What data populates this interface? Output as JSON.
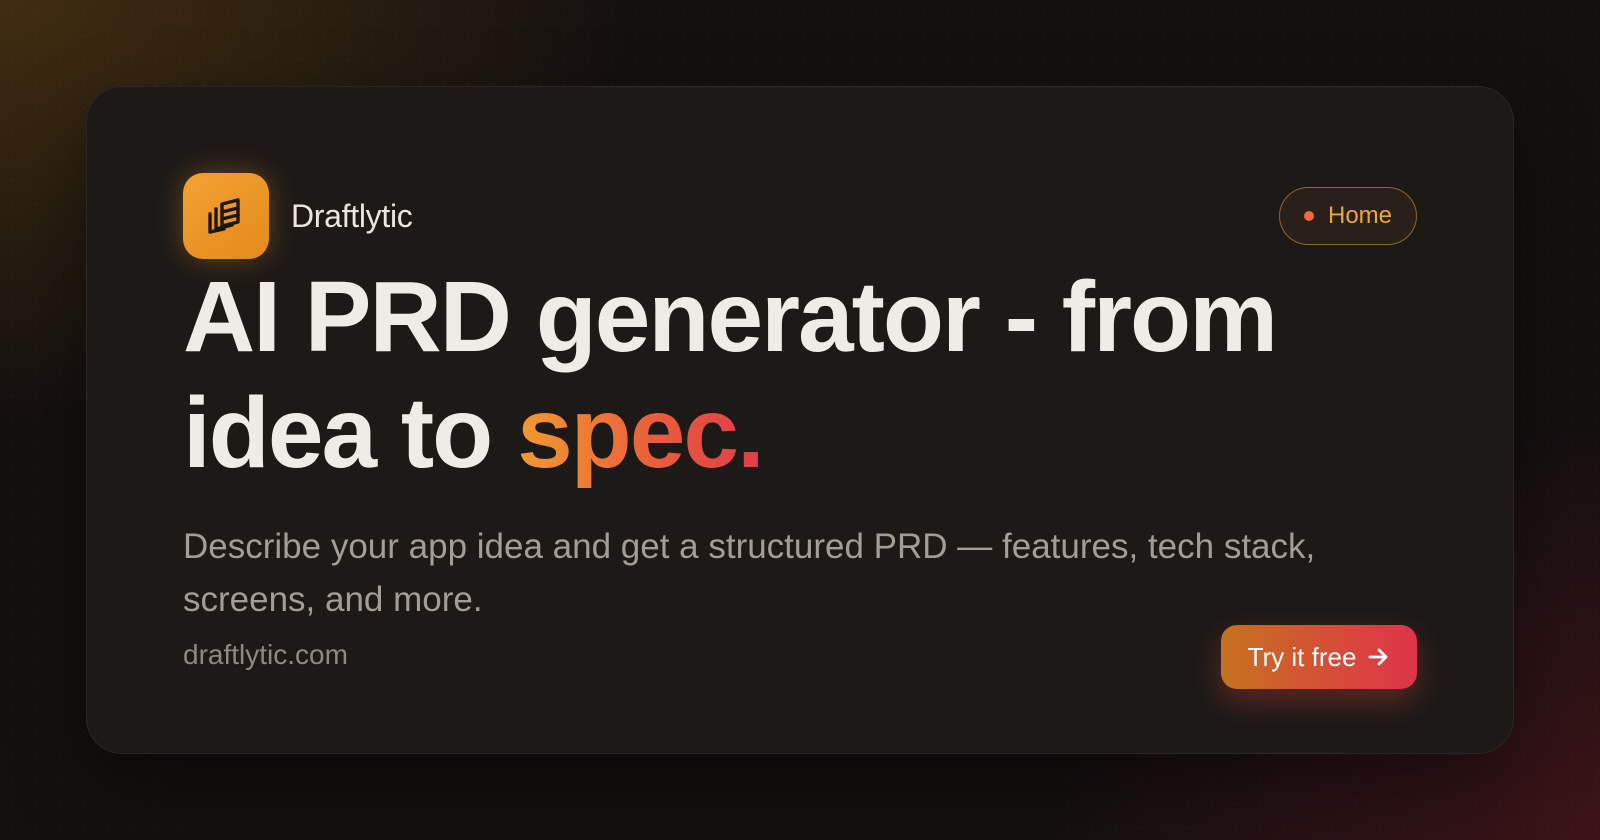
{
  "brand": {
    "name": "Draftlytic",
    "logo_icon": "stacked-pages-icon",
    "logo_color": "#F0A03A"
  },
  "nav": {
    "home_label": "Home",
    "dot_color": "#EE6A3A"
  },
  "hero": {
    "headline_main": "AI PRD generator - from idea to ",
    "headline_accent": "spec.",
    "subtitle": "Describe your app idea and get a structured PRD — features, tech stack, screens, and more.",
    "domain": "draftlytic.com"
  },
  "cta": {
    "label": "Try it free",
    "icon": "arrow-right-icon"
  },
  "colors": {
    "accent_start": "#F19A32",
    "accent_end": "#E23A4B",
    "card_bg": "#1C1917"
  }
}
